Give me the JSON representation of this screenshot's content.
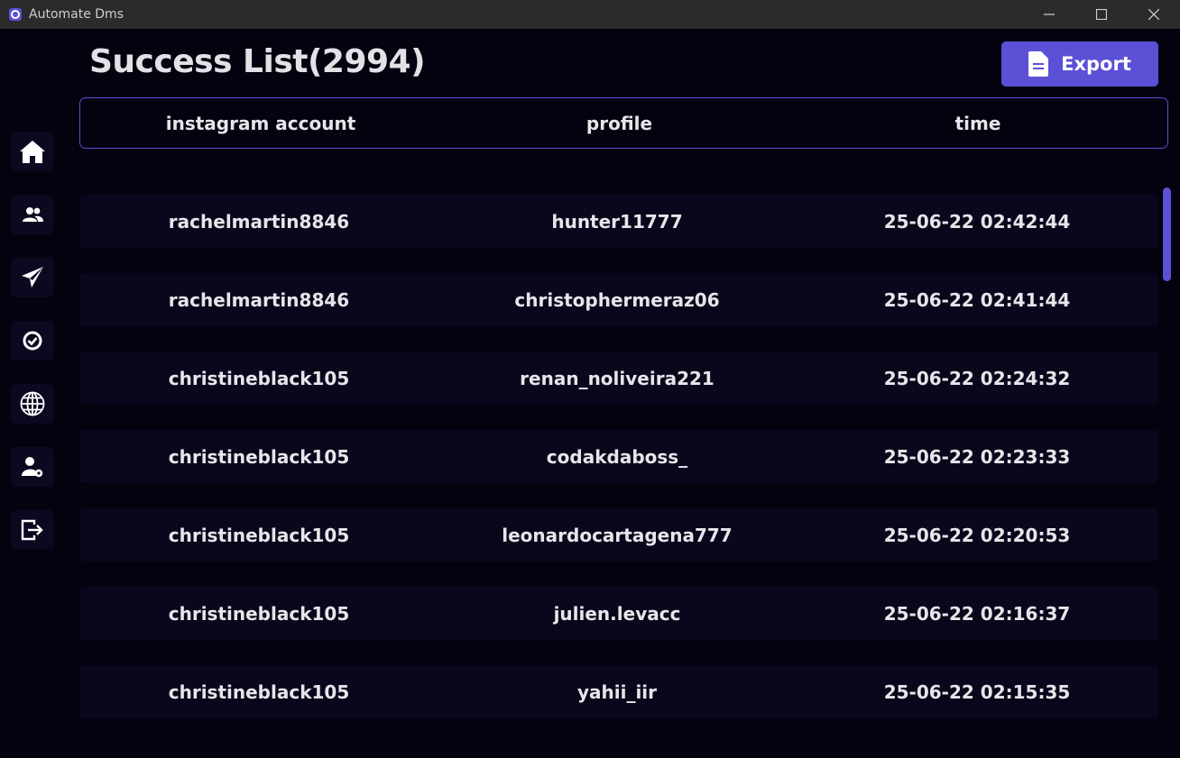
{
  "window": {
    "title": "Automate Dms"
  },
  "header": {
    "title": "Success List(2994)",
    "export_label": "Export"
  },
  "sidebar": {
    "items": [
      {
        "icon": "home-icon"
      },
      {
        "icon": "users-icon"
      },
      {
        "icon": "send-icon"
      },
      {
        "icon": "check-circle-icon"
      },
      {
        "icon": "globe-icon"
      },
      {
        "icon": "user-settings-icon"
      },
      {
        "icon": "logout-icon"
      }
    ]
  },
  "table": {
    "columns": [
      "instagram account",
      "profile",
      "time"
    ],
    "rows": [
      {
        "account": "rachelmartin8846",
        "profile": "hunter11777",
        "time": "25-06-22 02:42:44"
      },
      {
        "account": "rachelmartin8846",
        "profile": "christophermeraz06",
        "time": "25-06-22 02:41:44"
      },
      {
        "account": "christineblack105",
        "profile": "renan_noliveira221",
        "time": "25-06-22 02:24:32"
      },
      {
        "account": "christineblack105",
        "profile": "codakdaboss_",
        "time": "25-06-22 02:23:33"
      },
      {
        "account": "christineblack105",
        "profile": "leonardocartagena777",
        "time": "25-06-22 02:20:53"
      },
      {
        "account": "christineblack105",
        "profile": "julien.levacc",
        "time": "25-06-22 02:16:37"
      },
      {
        "account": "christineblack105",
        "profile": "yahii_iir",
        "time": "25-06-22 02:15:35"
      }
    ]
  },
  "colors": {
    "accent": "#5b50d6",
    "background": "#04020f",
    "row": "#0b061c"
  }
}
